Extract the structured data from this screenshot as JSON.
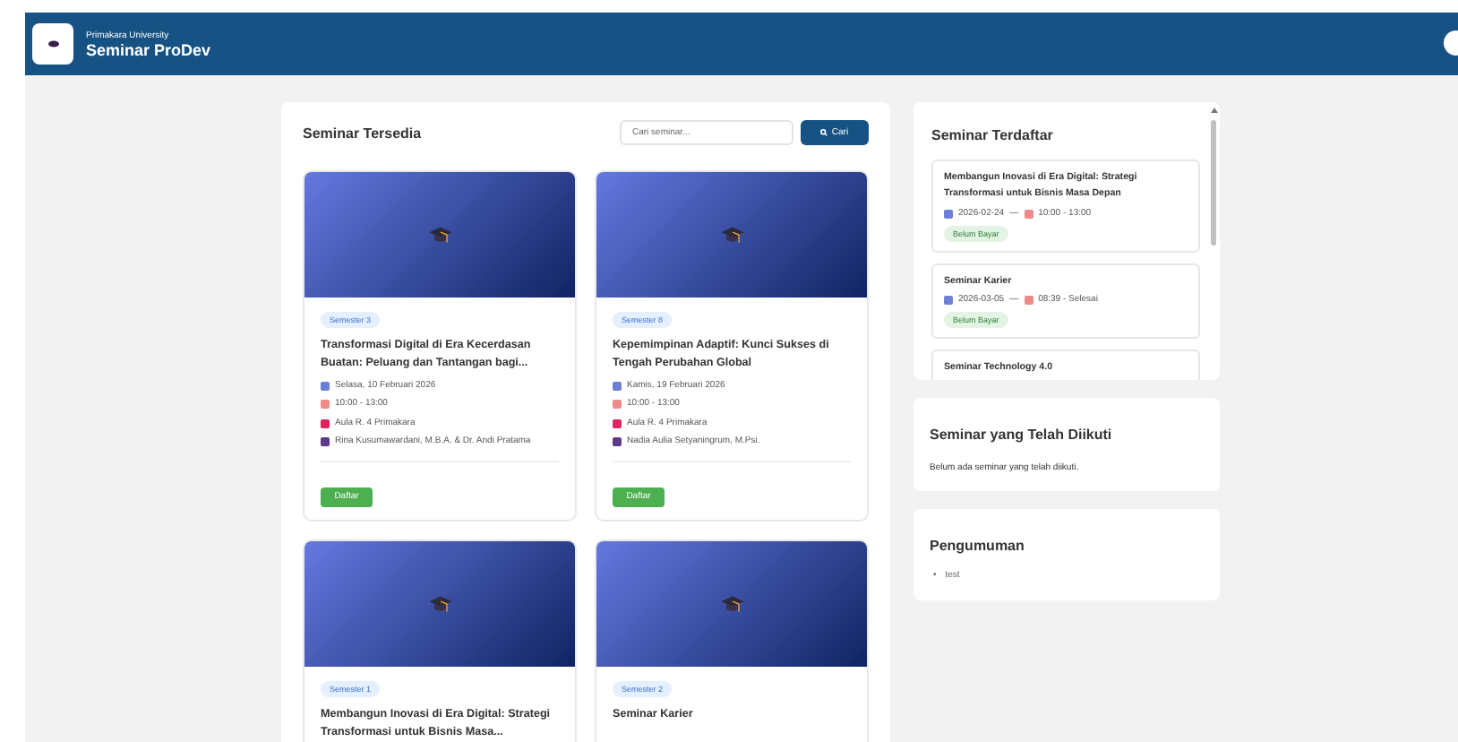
{
  "header": {
    "university": "Primakara University",
    "title": "Seminar ProDev"
  },
  "available": {
    "title": "Seminar Tersedia",
    "search": {
      "placeholder": "Cari seminar..."
    },
    "search_button": "Cari",
    "cards": [
      {
        "semester": "Semester 3",
        "title": "Transformasi Digital di Era Kecerdasan Buatan: Peluang dan Tantangan bagi...",
        "date": "Selasa, 10 Februari 2026",
        "time": "10:00 - 13:00",
        "place": "Aula R. 4 Primakara",
        "speaker": "Rina Kusumawardani, M.B.A. & Dr. Andi Pratama",
        "button": "Daftar"
      },
      {
        "semester": "Semester 8",
        "title": "Kepemimpinan Adaptif: Kunci Sukses di Tengah Perubahan Global",
        "date": "Kamis, 19 Februari 2026",
        "time": "10:00 - 13:00",
        "place": "Aula R. 4 Primakara",
        "speaker": "Nadia Aulia Setyaningrum, M.Psi.",
        "button": "Daftar"
      },
      {
        "semester": "Semester 1",
        "title": "Membangun Inovasi di Era Digital: Strategi Transformasi untuk Bisnis Masa..."
      },
      {
        "semester": "Semester 2",
        "title": "Seminar Karier"
      }
    ]
  },
  "registered": {
    "title": "Seminar Terdaftar",
    "items": [
      {
        "title": "Membangun Inovasi di Era Digital: Strategi Transformasi untuk Bisnis Masa Depan",
        "date": "2026-02-24",
        "separator": "—",
        "time": "10:00 - 13:00",
        "status": "Belum Bayar"
      },
      {
        "title": "Seminar Karier",
        "date": "2026-03-05",
        "separator": "—",
        "time": "08:39 - Selesai",
        "status": "Belum Bayar"
      },
      {
        "title": "Seminar Technology 4.0"
      }
    ]
  },
  "attended": {
    "title": "Seminar yang Telah Diikuti",
    "text": "Belum ada seminar yang telah diikuti."
  },
  "announcements": {
    "title": "Pengumuman",
    "items": [
      {
        "marker": "•",
        "text": "test"
      }
    ]
  }
}
